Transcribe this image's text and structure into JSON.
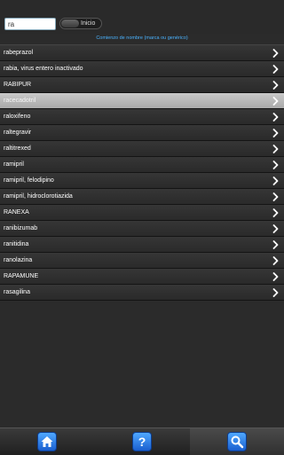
{
  "search": {
    "value": "ra",
    "placeholder": ""
  },
  "toggle": {
    "label": "Inicio"
  },
  "hint": "Comienzo de nombre (marca ou genérico)",
  "items": [
    {
      "label": "rabeprazol"
    },
    {
      "label": "rabia, virus entero inactivado"
    },
    {
      "label": "RABIPUR"
    },
    {
      "label": "racecadotril",
      "selected": true
    },
    {
      "label": "raloxifeno"
    },
    {
      "label": "raltegravir"
    },
    {
      "label": "raltitrexed"
    },
    {
      "label": "ramipril"
    },
    {
      "label": "ramipril, felodipino"
    },
    {
      "label": "ramipril, hidroclorotiazida"
    },
    {
      "label": "RANEXA"
    },
    {
      "label": "ranibizumab"
    },
    {
      "label": "ranitidina"
    },
    {
      "label": "ranolazina"
    },
    {
      "label": "RAPAMUNE"
    },
    {
      "label": "rasagilina"
    }
  ],
  "toolbar": {
    "tabs": [
      "home-icon",
      "help-icon",
      "search-icon"
    ],
    "active_tab": "search-icon"
  },
  "colors": {
    "accent": "#4ab3ff",
    "button_blue": "#2e7fe8",
    "selected_row": "#b8b8b8"
  }
}
